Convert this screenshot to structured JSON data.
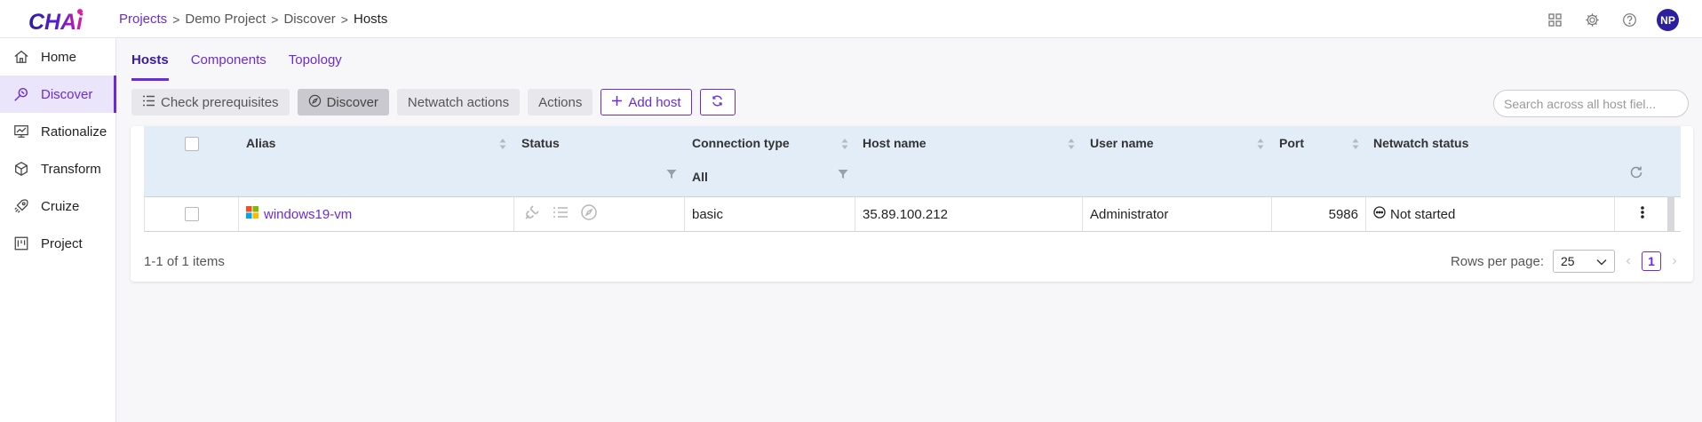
{
  "app": {
    "logo_text": "CHAI",
    "accent_color": "#6b2bd9",
    "avatar_initials": "NP"
  },
  "breadcrumb": {
    "items": [
      "Projects",
      "Demo Project",
      "Discover",
      "Hosts"
    ],
    "separator": ">"
  },
  "header_icons": [
    "apps-grid-icon",
    "gear-icon",
    "help-icon"
  ],
  "sidebar": {
    "items": [
      {
        "label": "Home",
        "icon": "home-icon",
        "active": false
      },
      {
        "label": "Discover",
        "icon": "discover-icon",
        "active": true
      },
      {
        "label": "Rationalize",
        "icon": "chart-icon",
        "active": false
      },
      {
        "label": "Transform",
        "icon": "cube-icon",
        "active": false
      },
      {
        "label": "Cruize",
        "icon": "rocket-icon",
        "active": false
      },
      {
        "label": "Project",
        "icon": "board-icon",
        "active": false
      }
    ]
  },
  "tabs": [
    {
      "label": "Hosts",
      "active": true
    },
    {
      "label": "Components",
      "active": false
    },
    {
      "label": "Topology",
      "active": false
    }
  ],
  "toolbar": {
    "check_prerequisites": "Check prerequisites",
    "discover": "Discover",
    "netwatch_actions": "Netwatch actions",
    "actions": "Actions",
    "add_host": "Add host"
  },
  "search": {
    "placeholder": "Search across all host fiel...",
    "value": ""
  },
  "table": {
    "columns": {
      "alias": "Alias",
      "status": "Status",
      "connection_type": "Connection type",
      "host_name": "Host name",
      "user_name": "User name",
      "port": "Port",
      "netwatch_status": "Netwatch status"
    },
    "filters": {
      "connection_type": "All"
    },
    "rows": [
      {
        "alias": "windows19-vm",
        "connection_type": "basic",
        "host_name": "35.89.100.212",
        "user_name": "Administrator",
        "port": "5986",
        "netwatch_status": "Not started"
      }
    ]
  },
  "pagination": {
    "summary": "1-1 of 1 items",
    "rows_per_page_label": "Rows per page:",
    "rows_per_page": "25",
    "current_page": "1"
  }
}
